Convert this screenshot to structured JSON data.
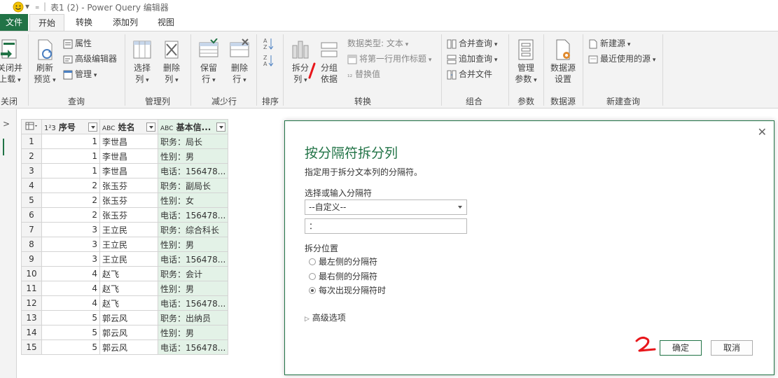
{
  "titlebar": {
    "title": "表1 (2) - Power Query 编辑器"
  },
  "tabs": [
    "文件",
    "开始",
    "转换",
    "添加列",
    "视图"
  ],
  "ribbon": {
    "close_group": {
      "btn1": "关闭并",
      "btn2": "上载",
      "label": "关闭"
    },
    "query_group": {
      "refresh": "刷新",
      "preview": "预览",
      "properties": "属性",
      "advanced_editor": "高级编辑器",
      "manage": "管理",
      "label": "查询"
    },
    "manage_cols_group": {
      "choose": "选择",
      "choose2": "列",
      "remove": "删除",
      "remove2": "列",
      "label": "管理列"
    },
    "reduce_rows_group": {
      "keep": "保留",
      "keep2": "行",
      "remove": "删除",
      "remove2": "行",
      "label": "减少行"
    },
    "sort_group": {
      "label": "排序"
    },
    "transform_group": {
      "split": "拆分",
      "split2": "列",
      "group": "分组",
      "group2": "依据",
      "datatype": "数据类型: 文本",
      "first_row_header": "将第一行用作标题",
      "replace": "替换值",
      "label": "转换"
    },
    "combine_group": {
      "merge": "合并查询",
      "append": "追加查询",
      "combine_files": "合并文件",
      "label": "组合"
    },
    "params_group": {
      "manage": "管理",
      "params": "参数",
      "label": "参数"
    },
    "datasource_group": {
      "settings": "数据源",
      "settings2": "设置",
      "label": "数据源"
    },
    "newquery_group": {
      "new_source": "新建源",
      "recent": "最近使用的源",
      "label": "新建查询"
    }
  },
  "grid": {
    "headers": [
      "序号",
      "姓名",
      "基本信..."
    ],
    "header_types": [
      "1²3",
      "ABC",
      "ABC"
    ],
    "rows": [
      [
        "1",
        "1",
        "李世昌",
        "职务：局长"
      ],
      [
        "2",
        "1",
        "李世昌",
        "性别：男"
      ],
      [
        "3",
        "1",
        "李世昌",
        "电话：156478..."
      ],
      [
        "4",
        "2",
        "张玉芬",
        "职务：副局长"
      ],
      [
        "5",
        "2",
        "张玉芬",
        "性别：女"
      ],
      [
        "6",
        "2",
        "张玉芬",
        "电话：156478..."
      ],
      [
        "7",
        "3",
        "王立民",
        "职务：综合科长"
      ],
      [
        "8",
        "3",
        "王立民",
        "性别：男"
      ],
      [
        "9",
        "3",
        "王立民",
        "电话：156478..."
      ],
      [
        "10",
        "4",
        "赵飞",
        "职务：会计"
      ],
      [
        "11",
        "4",
        "赵飞",
        "性别：男"
      ],
      [
        "12",
        "4",
        "赵飞",
        "电话：156478..."
      ],
      [
        "13",
        "5",
        "郭云风",
        "职务：出纳员"
      ],
      [
        "14",
        "5",
        "郭云风",
        "性别：男"
      ],
      [
        "15",
        "5",
        "郭云风",
        "电话：156478..."
      ]
    ]
  },
  "dialog": {
    "title": "按分隔符拆分列",
    "description": "指定用于拆分文本列的分隔符。",
    "delimiter_label": "选择或输入分隔符",
    "delimiter_select": "--自定义--",
    "delimiter_value": "：",
    "split_at_label": "拆分位置",
    "options": [
      "最左侧的分隔符",
      "最右侧的分隔符",
      "每次出现分隔符时"
    ],
    "selected_option": 2,
    "advanced": "高级选项",
    "ok": "确定",
    "cancel": "取消"
  },
  "annotations": {
    "mark1": "/",
    "mark2": "2",
    "color": "#e8161b"
  },
  "colors": {
    "accent": "#217346",
    "selected_col": "#e3f2e7"
  }
}
